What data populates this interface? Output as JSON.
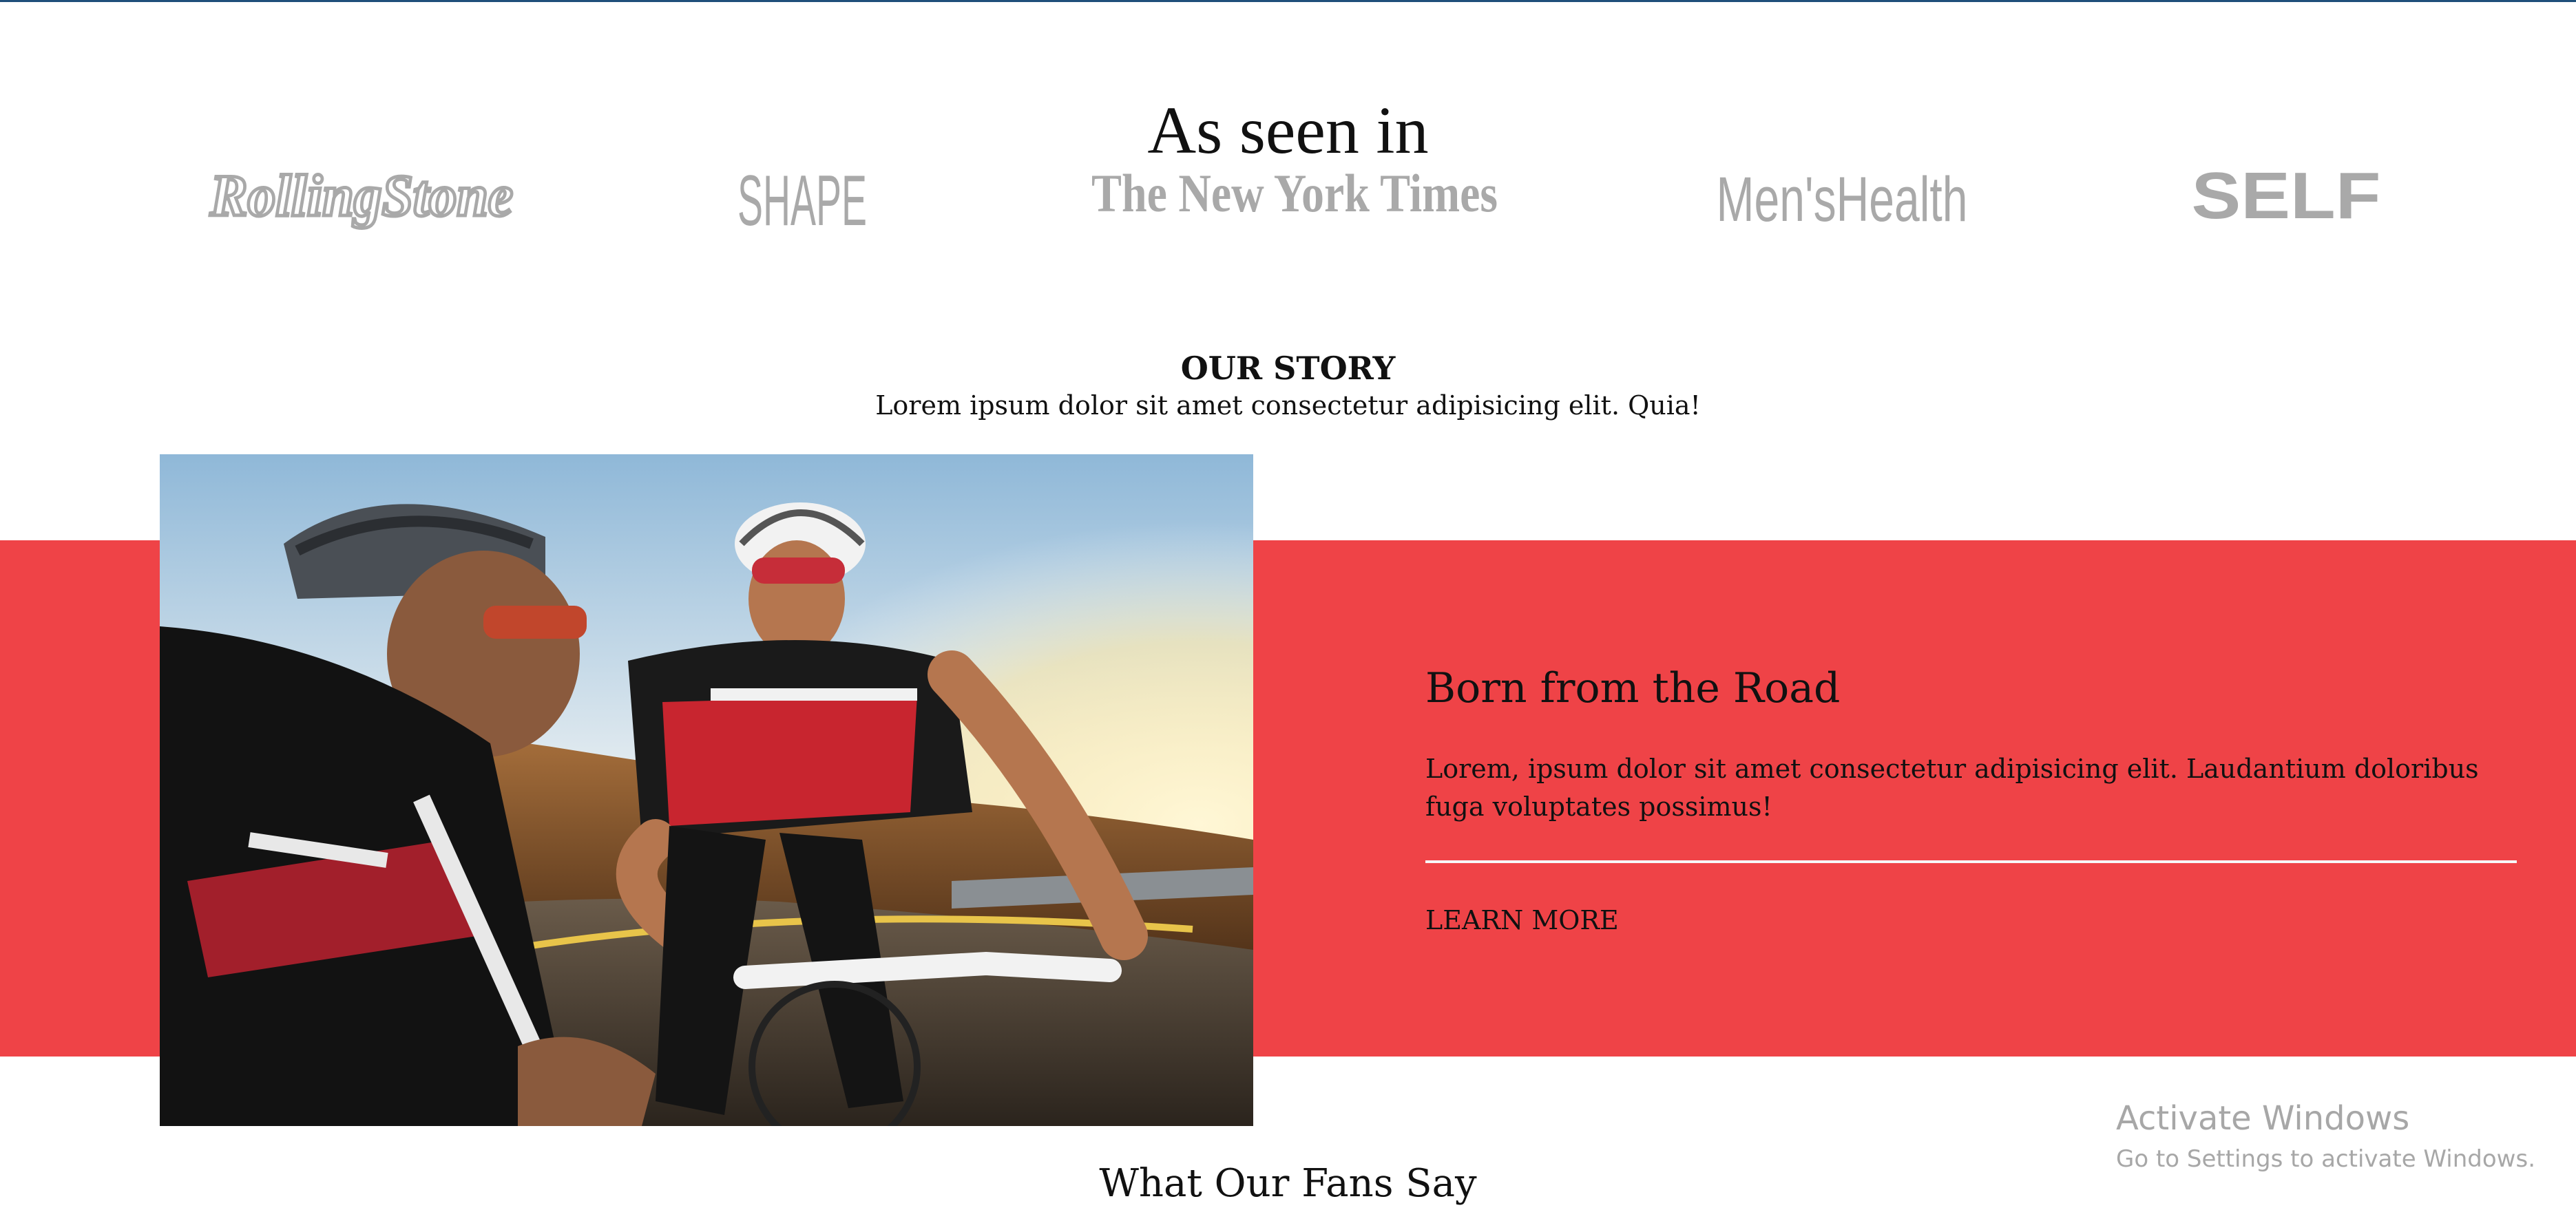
{
  "as_seen_in": {
    "title": "As seen in",
    "logos": [
      {
        "name": "Rolling Stone",
        "text": "RollingStone"
      },
      {
        "name": "Shape",
        "text": "SHAPE"
      },
      {
        "name": "The New York Times",
        "text": "The New York Times"
      },
      {
        "name": "Men's Health",
        "text": "Men'sHealth"
      },
      {
        "name": "Self",
        "text": "SELF"
      }
    ],
    "logo_color": "#a9a9a9"
  },
  "story": {
    "title": "OUR STORY",
    "subtitle": "Lorem ipsum dolor sit amet consectetur adipisicing elit. Quia!"
  },
  "feature": {
    "heading": "Born from the Road",
    "text": "Lorem, ipsum dolor sit amet consectetur adipisicing elit. Laudantium doloribus fuga voluptates possimus!",
    "link_label": "LEARN MORE",
    "band_color": "#ef4347"
  },
  "fans": {
    "title": "What Our Fans Say"
  },
  "windows_watermark": {
    "title": "Activate Windows",
    "subtitle": "Go to Settings to activate Windows."
  }
}
